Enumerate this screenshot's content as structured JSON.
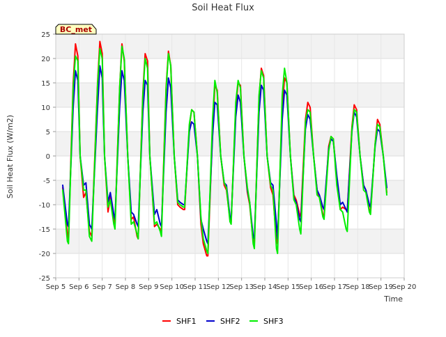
{
  "chart_data": {
    "type": "line",
    "title": "Soil Heat Flux",
    "xlabel": "Time",
    "ylabel": "Soil Heat Flux (W/m2)",
    "site_label": "BC_met",
    "ylim": [
      -25,
      25
    ],
    "yticks": [
      -25,
      -20,
      -15,
      -10,
      -5,
      0,
      5,
      10,
      15,
      20,
      25
    ],
    "xlim": [
      5,
      20
    ],
    "xticks": [
      {
        "v": 5,
        "label": "Sep 5"
      },
      {
        "v": 6,
        "label": "Sep 6"
      },
      {
        "v": 7,
        "label": "Sep 7"
      },
      {
        "v": 8,
        "label": "Sep 8"
      },
      {
        "v": 9,
        "label": "Sep 9"
      },
      {
        "v": 10,
        "label": "Sep 10"
      },
      {
        "v": 11,
        "label": "Sep 11"
      },
      {
        "v": 12,
        "label": "Sep 12"
      },
      {
        "v": 13,
        "label": "Sep 13"
      },
      {
        "v": 14,
        "label": "Sep 14"
      },
      {
        "v": 15,
        "label": "Sep 15"
      },
      {
        "v": 16,
        "label": "Sep 16"
      },
      {
        "v": 17,
        "label": "Sep 17"
      },
      {
        "v": 18,
        "label": "Sep 18"
      },
      {
        "v": 19,
        "label": "Sep 19"
      },
      {
        "v": 20,
        "label": "Sep 20"
      }
    ],
    "legend_position": "bottom",
    "grid": true,
    "series": [
      {
        "name": "SHF1",
        "color": "#ff0000",
        "x": [
          5.3,
          5.5,
          5.55,
          5.75,
          5.85,
          5.95,
          6.05,
          6.2,
          6.3,
          6.45,
          6.55,
          6.8,
          6.9,
          7.0,
          7.1,
          7.25,
          7.35,
          7.5,
          7.55,
          7.75,
          7.85,
          7.95,
          8.1,
          8.25,
          8.35,
          8.5,
          8.55,
          8.75,
          8.85,
          8.95,
          9.05,
          9.25,
          9.35,
          9.5,
          9.55,
          9.75,
          9.85,
          9.95,
          10.1,
          10.25,
          10.35,
          10.5,
          10.55,
          10.75,
          10.85,
          10.95,
          11.1,
          11.25,
          11.35,
          11.5,
          11.55,
          11.75,
          11.85,
          11.95,
          12.1,
          12.25,
          12.35,
          12.5,
          12.55,
          12.75,
          12.85,
          12.95,
          13.1,
          13.25,
          13.35,
          13.5,
          13.55,
          13.75,
          13.85,
          13.95,
          14.1,
          14.25,
          14.35,
          14.5,
          14.55,
          14.75,
          14.85,
          14.95,
          15.1,
          15.25,
          15.35,
          15.5,
          15.55,
          15.75,
          15.85,
          15.95,
          16.1,
          16.25,
          16.35,
          16.5,
          16.55,
          16.75,
          16.85,
          16.95,
          17.1,
          17.25,
          17.35,
          17.5,
          17.55,
          17.75,
          17.85,
          17.95,
          18.1,
          18.25,
          18.35,
          18.5,
          18.55,
          18.75,
          18.85,
          18.95,
          19.1,
          19.25
        ],
        "y": [
          -6.5,
          -16.0,
          -17.0,
          15.0,
          23.0,
          20.5,
          0.0,
          -8.5,
          -7.5,
          -15.5,
          -16.5,
          15.0,
          23.5,
          21.0,
          0.0,
          -11.5,
          -8.5,
          -13.0,
          -14.0,
          14.0,
          23.0,
          19.5,
          0.0,
          -13.0,
          -12.5,
          -16.5,
          -17.0,
          13.0,
          21.0,
          19.5,
          0.0,
          -14.5,
          -14.0,
          -15.0,
          -15.5,
          14.0,
          21.5,
          18.5,
          0.0,
          -10.0,
          -10.5,
          -11.0,
          -11.0,
          6.0,
          9.5,
          9.0,
          0.0,
          -14.0,
          -18.0,
          -20.5,
          -20.5,
          5.0,
          14.5,
          13.5,
          0.0,
          -6.0,
          -7.0,
          -13.0,
          -13.5,
          10.0,
          15.0,
          14.5,
          0.0,
          -7.5,
          -10.0,
          -17.5,
          -18.0,
          12.0,
          18.0,
          16.5,
          0.0,
          -6.5,
          -8.0,
          -17.5,
          -18.0,
          10.0,
          16.0,
          15.0,
          0.0,
          -8.0,
          -9.0,
          -12.0,
          -12.5,
          7.5,
          11.0,
          10.0,
          0.0,
          -7.0,
          -8.5,
          -12.0,
          -12.5,
          2.0,
          4.0,
          3.5,
          -5.0,
          -11.0,
          -10.5,
          -11.0,
          -11.5,
          6.0,
          10.5,
          9.5,
          0.0,
          -6.0,
          -7.0,
          -11.0,
          -11.5,
          2.5,
          7.5,
          6.5,
          0.0,
          -7.5
        ]
      },
      {
        "name": "SHF2",
        "color": "#0000cc",
        "x": [
          5.3,
          5.5,
          5.55,
          5.75,
          5.85,
          5.95,
          6.05,
          6.2,
          6.3,
          6.45,
          6.55,
          6.8,
          6.9,
          7.0,
          7.1,
          7.25,
          7.35,
          7.5,
          7.55,
          7.75,
          7.85,
          7.95,
          8.1,
          8.25,
          8.35,
          8.5,
          8.55,
          8.75,
          8.85,
          8.95,
          9.05,
          9.25,
          9.35,
          9.5,
          9.55,
          9.75,
          9.85,
          9.95,
          10.1,
          10.25,
          10.35,
          10.5,
          10.55,
          10.75,
          10.85,
          10.95,
          11.1,
          11.25,
          11.35,
          11.5,
          11.55,
          11.75,
          11.85,
          11.95,
          12.1,
          12.25,
          12.35,
          12.5,
          12.55,
          12.75,
          12.85,
          12.95,
          13.1,
          13.25,
          13.35,
          13.5,
          13.55,
          13.75,
          13.85,
          13.95,
          14.1,
          14.25,
          14.35,
          14.5,
          14.55,
          14.75,
          14.85,
          14.95,
          15.1,
          15.25,
          15.35,
          15.5,
          15.55,
          15.75,
          15.85,
          15.95,
          16.1,
          16.25,
          16.35,
          16.5,
          16.55,
          16.75,
          16.85,
          16.95,
          17.1,
          17.25,
          17.35,
          17.5,
          17.55,
          17.75,
          17.85,
          17.95,
          18.1,
          18.25,
          18.35,
          18.5,
          18.55,
          18.75,
          18.85,
          18.95,
          19.1,
          19.25
        ],
        "y": [
          -6.0,
          -14.0,
          -14.5,
          10.0,
          17.5,
          15.5,
          0.0,
          -6.0,
          -5.5,
          -14.0,
          -15.0,
          10.0,
          18.5,
          16.0,
          0.0,
          -9.5,
          -7.5,
          -12.0,
          -13.0,
          10.0,
          17.5,
          15.5,
          0.0,
          -11.5,
          -12.0,
          -14.0,
          -14.5,
          9.0,
          15.5,
          14.5,
          0.0,
          -12.0,
          -11.0,
          -14.0,
          -14.5,
          9.0,
          16.0,
          14.0,
          0.0,
          -9.0,
          -9.5,
          -10.0,
          -10.0,
          5.0,
          7.0,
          6.5,
          0.0,
          -13.0,
          -15.0,
          -17.5,
          -18.0,
          4.0,
          11.0,
          10.5,
          0.0,
          -5.5,
          -6.0,
          -12.5,
          -13.0,
          8.0,
          12.5,
          11.0,
          0.0,
          -7.0,
          -9.5,
          -16.5,
          -17.0,
          9.0,
          14.5,
          13.5,
          0.0,
          -5.5,
          -6.0,
          -14.0,
          -17.0,
          7.5,
          13.5,
          12.5,
          0.0,
          -8.5,
          -9.5,
          -13.0,
          -13.5,
          5.5,
          8.5,
          7.5,
          0.0,
          -7.0,
          -8.0,
          -10.5,
          -11.0,
          1.5,
          3.5,
          3.0,
          -4.0,
          -10.0,
          -9.5,
          -11.0,
          -11.5,
          5.0,
          9.0,
          8.0,
          0.0,
          -6.0,
          -7.0,
          -10.0,
          -10.5,
          2.0,
          5.5,
          5.0,
          0.0,
          -6.5
        ]
      },
      {
        "name": "SHF3",
        "color": "#00ee00",
        "x": [
          5.3,
          5.5,
          5.55,
          5.75,
          5.85,
          5.95,
          6.05,
          6.2,
          6.3,
          6.45,
          6.55,
          6.8,
          6.9,
          7.0,
          7.1,
          7.25,
          7.35,
          7.5,
          7.55,
          7.75,
          7.85,
          7.95,
          8.1,
          8.25,
          8.35,
          8.5,
          8.55,
          8.75,
          8.85,
          8.95,
          9.05,
          9.25,
          9.35,
          9.5,
          9.55,
          9.75,
          9.85,
          9.95,
          10.1,
          10.25,
          10.35,
          10.5,
          10.55,
          10.75,
          10.85,
          10.95,
          11.1,
          11.25,
          11.35,
          11.5,
          11.55,
          11.75,
          11.85,
          11.95,
          12.1,
          12.25,
          12.35,
          12.5,
          12.55,
          12.75,
          12.85,
          12.95,
          13.1,
          13.25,
          13.35,
          13.5,
          13.55,
          13.75,
          13.85,
          13.95,
          14.1,
          14.25,
          14.35,
          14.5,
          14.55,
          14.75,
          14.85,
          14.95,
          15.1,
          15.25,
          15.35,
          15.5,
          15.55,
          15.75,
          15.85,
          15.95,
          16.1,
          16.25,
          16.35,
          16.5,
          16.55,
          16.75,
          16.85,
          16.95,
          17.1,
          17.25,
          17.35,
          17.5,
          17.55,
          17.75,
          17.85,
          17.95,
          18.1,
          18.25,
          18.35,
          18.5,
          18.55,
          18.75,
          18.85,
          18.95,
          19.1,
          19.25
        ],
        "y": [
          -7.0,
          -17.5,
          -18.0,
          14.0,
          20.5,
          19.5,
          0.0,
          -7.0,
          -7.0,
          -16.5,
          -17.5,
          14.5,
          22.0,
          20.0,
          0.0,
          -10.5,
          -9.0,
          -14.0,
          -15.0,
          14.0,
          22.5,
          20.0,
          0.0,
          -14.0,
          -13.5,
          -16.0,
          -17.0,
          12.5,
          20.0,
          18.0,
          0.0,
          -14.0,
          -13.5,
          -15.5,
          -16.5,
          13.5,
          21.0,
          18.5,
          0.0,
          -9.5,
          -10.0,
          -10.5,
          -10.5,
          6.5,
          9.5,
          9.0,
          0.0,
          -12.5,
          -17.0,
          -19.5,
          -20.0,
          7.5,
          15.5,
          13.0,
          0.0,
          -5.5,
          -6.5,
          -13.5,
          -14.0,
          11.0,
          15.5,
          14.0,
          0.0,
          -6.5,
          -9.5,
          -18.0,
          -19.0,
          12.5,
          17.5,
          16.0,
          0.0,
          -6.0,
          -7.0,
          -19.0,
          -20.0,
          12.5,
          18.0,
          15.0,
          0.0,
          -9.0,
          -10.0,
          -15.0,
          -16.0,
          7.0,
          9.5,
          9.0,
          0.0,
          -8.0,
          -8.5,
          -12.5,
          -13.0,
          1.0,
          4.0,
          3.5,
          -6.0,
          -11.0,
          -11.5,
          -15.0,
          -15.5,
          5.5,
          9.5,
          9.0,
          0.0,
          -7.0,
          -7.5,
          -11.5,
          -12.0,
          2.5,
          6.5,
          6.0,
          0.0,
          -8.0
        ]
      }
    ]
  }
}
